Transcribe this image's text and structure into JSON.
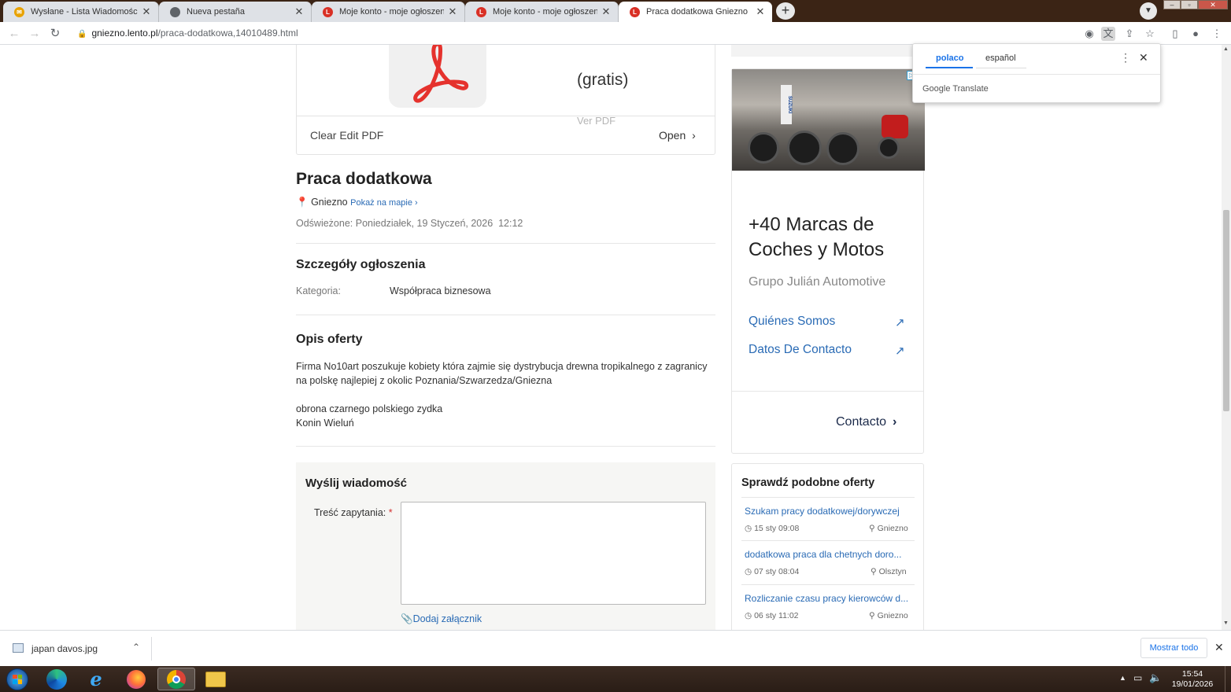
{
  "browser": {
    "tabs": [
      {
        "title": "Wysłane - Lista Wiadomości - Po",
        "favicon_color": "#e8a200",
        "active": false
      },
      {
        "title": "Nueva pestaña",
        "favicon_color": "#5f6368",
        "active": false
      },
      {
        "title": "Moje konto - moje ogłoszenia - L",
        "favicon_color": "#d93025",
        "active": false
      },
      {
        "title": "Moje konto - moje ogłoszenia - L",
        "favicon_color": "#d93025",
        "active": false
      },
      {
        "title": "Praca dodatkowa Gniezno",
        "favicon_color": "#d93025",
        "active": true
      }
    ],
    "url_domain": "gniezno.lento.pl",
    "url_path": "/praca-dodatkowa,14010489.html"
  },
  "pdf_card": {
    "partial_title": "(gratis)",
    "view_pdf": "Ver PDF",
    "name": "Clear Edit PDF",
    "open_label": "Open",
    "logo_color": "#e5322d"
  },
  "listing": {
    "title": "Praca dodatkowa",
    "city": "Gniezno",
    "map_link": "Pokaż na mapie ›",
    "refreshed": "Odświeżone: Poniedziałek, 19 Styczeń, 2026  12:12",
    "details_heading": "Szczegóły ogłoszenia",
    "category_label": "Kategoria:",
    "category_value": "Współpraca biznesowa",
    "description_heading": "Opis oferty",
    "description_line1": "Firma No10art poszukuje kobiety która zajmie się dystrybucja drewna tropikalnego z zagranicy",
    "description_line2": "na polskę najlepiej z okolic Poznania/Szwarzedza/Gniezna",
    "description_line3": "obrona czarnego polskiego zydka",
    "description_line4": "Konin Wieluń",
    "pin_color": "#e66a2c"
  },
  "message_form": {
    "heading": "Wyślij wiadomość",
    "field_label": "Treść zapytania:",
    "required_mark": "*",
    "attach_label": "Dodaj załącznik",
    "textarea_value": ""
  },
  "ad": {
    "headline_line1": "+40 Marcas de",
    "headline_line2": "Coches y Motos",
    "advertiser": "Grupo Julián Automotive",
    "link1": "Quiénes Somos",
    "link2": "Datos De Contacto",
    "cta": "Contacto",
    "sign_text": "SUZUKI"
  },
  "similar_offers": {
    "heading": "Sprawdź podobne oferty",
    "items": [
      {
        "title": "Szukam pracy dodatkowej/dorywczej",
        "time": "15 sty 09:08",
        "city": "Gniezno"
      },
      {
        "title": "dodatkowa praca dla chetnych doro...",
        "time": "07 sty 08:04",
        "city": "Olsztyn"
      },
      {
        "title": "Rozliczanie czasu pracy kierowców d...",
        "time": "06 sty 11:02",
        "city": "Gniezno"
      }
    ]
  },
  "translate_popup": {
    "lang_source": "polaco",
    "lang_target": "español",
    "brand": "Google Translate",
    "accent": "#1a73e8"
  },
  "download_bar": {
    "filename": "japan davos.jpg",
    "show_all": "Mostrar todo"
  },
  "taskbar": {
    "time": "15:54",
    "date": "19/01/2026"
  }
}
